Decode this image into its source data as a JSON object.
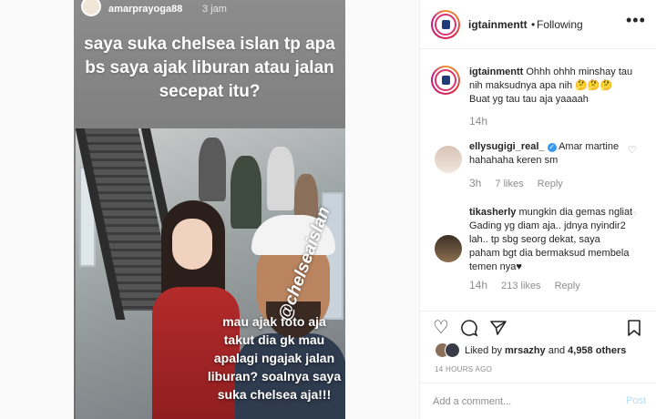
{
  "story": {
    "username": "amarprayoga88",
    "time": "3 jam",
    "caption": "saya suka chelsea islan tp apa bs saya ajak liburan atau jalan secepat itu?",
    "overlay_text": "mau ajak foto aja takut dia gk mau apalagi ngajak jalan liburan? soalnya saya suka chelsea aja!!!",
    "sticker": "@chelseaislan"
  },
  "post": {
    "username": "igtainmentt",
    "separator": "•",
    "follow_status": "Following",
    "more_icon": "more-horizontal-icon"
  },
  "comments": [
    {
      "user": "igtainmentt",
      "text": "Ohhh ohhh minshay tau nih maksudnya apa nih 🤔🤔🤔 Buat yg tau tau aja yaaaah",
      "time": "14h"
    },
    {
      "user": "ellysugigi_real_",
      "text": "Amar martine hahahaha keren sm",
      "time": "3h",
      "likes": "7 likes",
      "reply": "Reply",
      "verified": true
    },
    {
      "user": "tikasherly",
      "text": "mungkin dia gemas ngliat Gading yg diam aja.. jdnya nyindir2 lah.. tp sbg seorg dekat, saya paham bgt dia bermaksud membela temen nya♥",
      "time": "14h",
      "likes": "213 likes",
      "reply": "Reply"
    }
  ],
  "actions": {
    "like_icon": "heart-icon",
    "comment_icon": "comment-icon",
    "share_icon": "share-icon",
    "save_icon": "bookmark-icon"
  },
  "likes": {
    "prefix": "Liked by ",
    "user": "mrsazhy",
    "middle": " and ",
    "count": "4,958 others"
  },
  "posted_time": "14 HOURS AGO",
  "add_comment": {
    "placeholder": "Add a comment...",
    "post_label": "Post"
  },
  "colors": {
    "link_blue": "#3897f0",
    "post_disabled": "#b2dffc",
    "muted": "#8e8e8e",
    "text": "#262626"
  }
}
